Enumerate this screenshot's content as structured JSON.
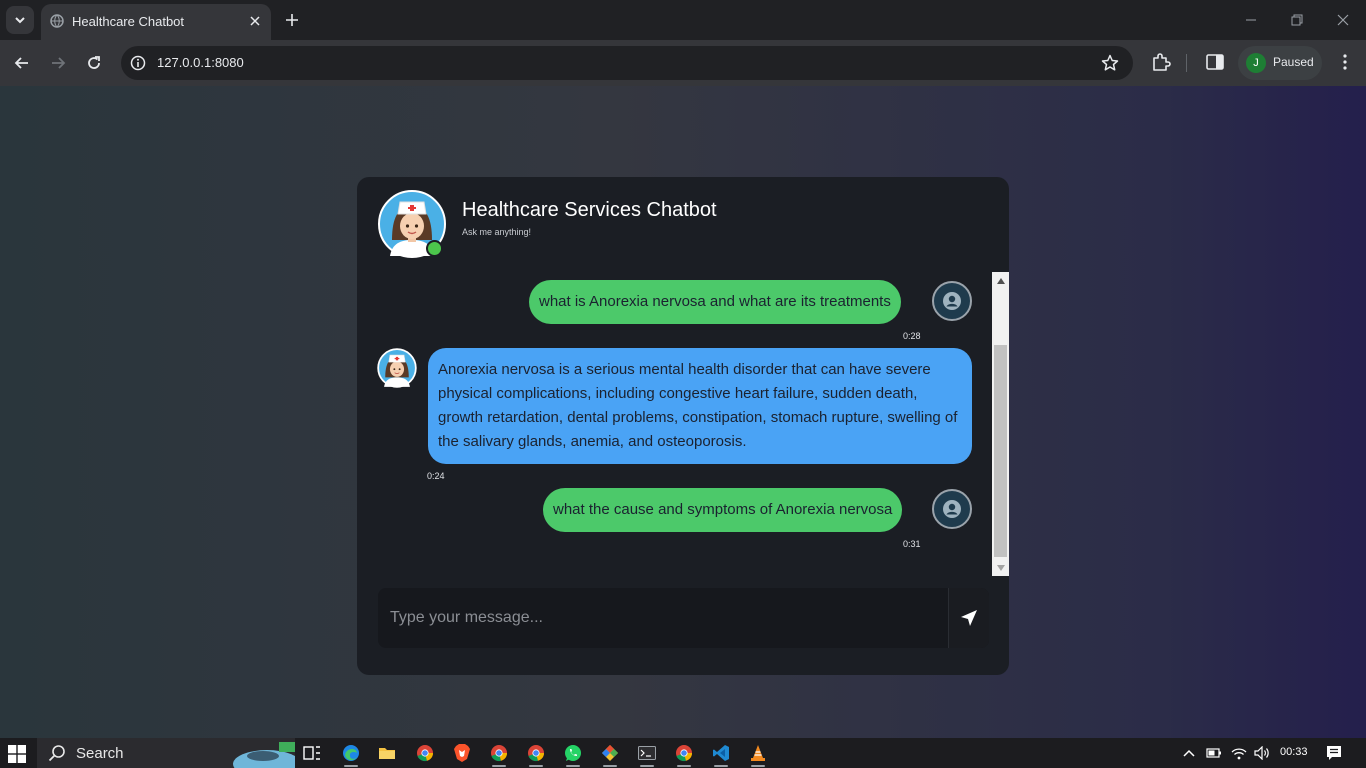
{
  "browser": {
    "tab_title": "Healthcare Chatbot",
    "url": "127.0.0.1:8080",
    "profile_initial": "J",
    "profile_status": "Paused"
  },
  "chat": {
    "title": "Healthcare Services Chatbot",
    "subtitle": "Ask me anything!",
    "input_placeholder": "Type your message...",
    "messages": [
      {
        "sender": "user",
        "text": "what is Anorexia nervosa and what are its treatments",
        "time": "0:28"
      },
      {
        "sender": "bot",
        "text": "Anorexia nervosa is a serious mental health disorder that can have severe physical complications, including congestive heart failure, sudden death, growth retardation, dental problems, constipation, stomach rupture, swelling of the salivary glands, anemia, and osteoporosis.",
        "time": "0:24"
      },
      {
        "sender": "user",
        "text": "what the cause and symptoms of Anorexia nervosa",
        "time": "0:31"
      }
    ]
  },
  "taskbar": {
    "search_label": "Search",
    "clock": "00:33",
    "apps": [
      "task-view-icon",
      "edge-icon",
      "file-explorer-icon",
      "chrome-icon",
      "brave-icon",
      "chrome-icon",
      "chrome-icon",
      "whatsapp-icon",
      "git-icon",
      "terminal-icon",
      "chrome-icon",
      "vscode-icon",
      "vlc-icon"
    ]
  },
  "colors": {
    "user_bubble": "#4cc96a",
    "bot_bubble": "#4aa3f5",
    "card_bg": "#1b1e24",
    "online": "#4cc64c"
  }
}
